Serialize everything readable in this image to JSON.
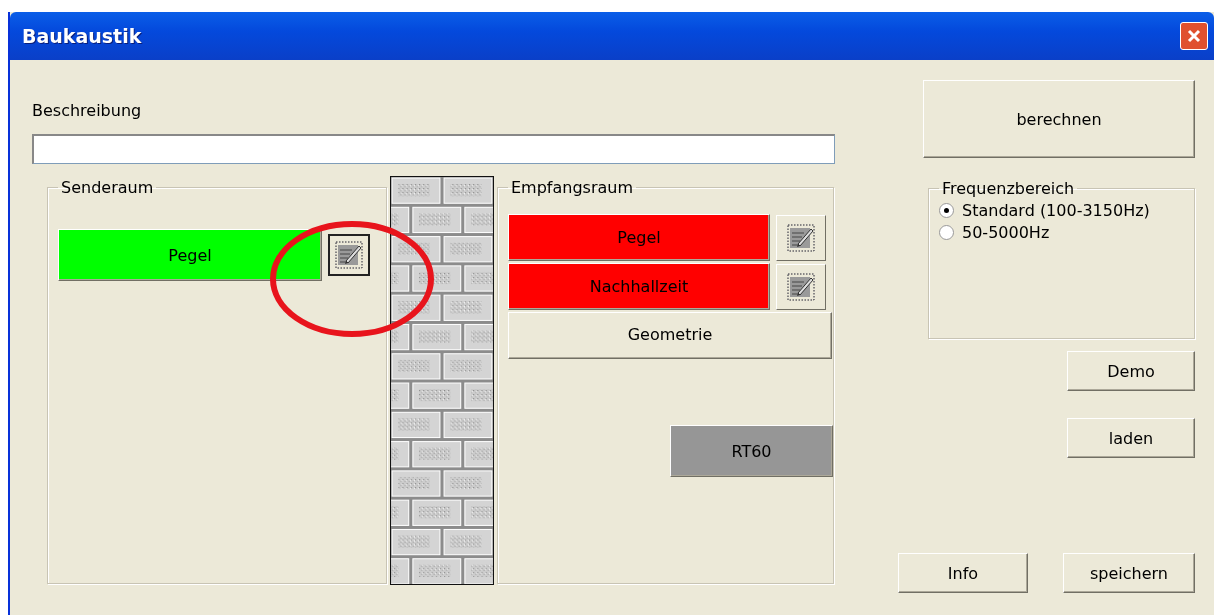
{
  "window": {
    "title": "Baukaustik"
  },
  "description": {
    "label": "Beschreibung"
  },
  "sender": {
    "title": "Senderaum",
    "buttons": [
      {
        "label": "Pegel",
        "color": "#00ff00",
        "editable": true
      }
    ]
  },
  "receiver": {
    "title": "Empfangsraum",
    "buttons": [
      {
        "label": "Pegel",
        "color": "#ff0000",
        "editable": true
      },
      {
        "label": "Nachhallzeit",
        "color": "#ff0000",
        "editable": true
      },
      {
        "label": "Geometrie",
        "color": "#ece9d8",
        "editable": false
      }
    ],
    "rt60": {
      "label": "RT60",
      "color": "#969696"
    }
  },
  "calculate_button": "berechnen",
  "frequency": {
    "title": "Frequenzbereich",
    "options": [
      {
        "label": "Standard (100-3150Hz)",
        "selected": true
      },
      {
        "label": "50-5000Hz",
        "selected": false
      }
    ]
  },
  "side_buttons": [
    "Demo",
    "laden"
  ],
  "bottom_buttons": [
    "Info",
    "speichern"
  ]
}
